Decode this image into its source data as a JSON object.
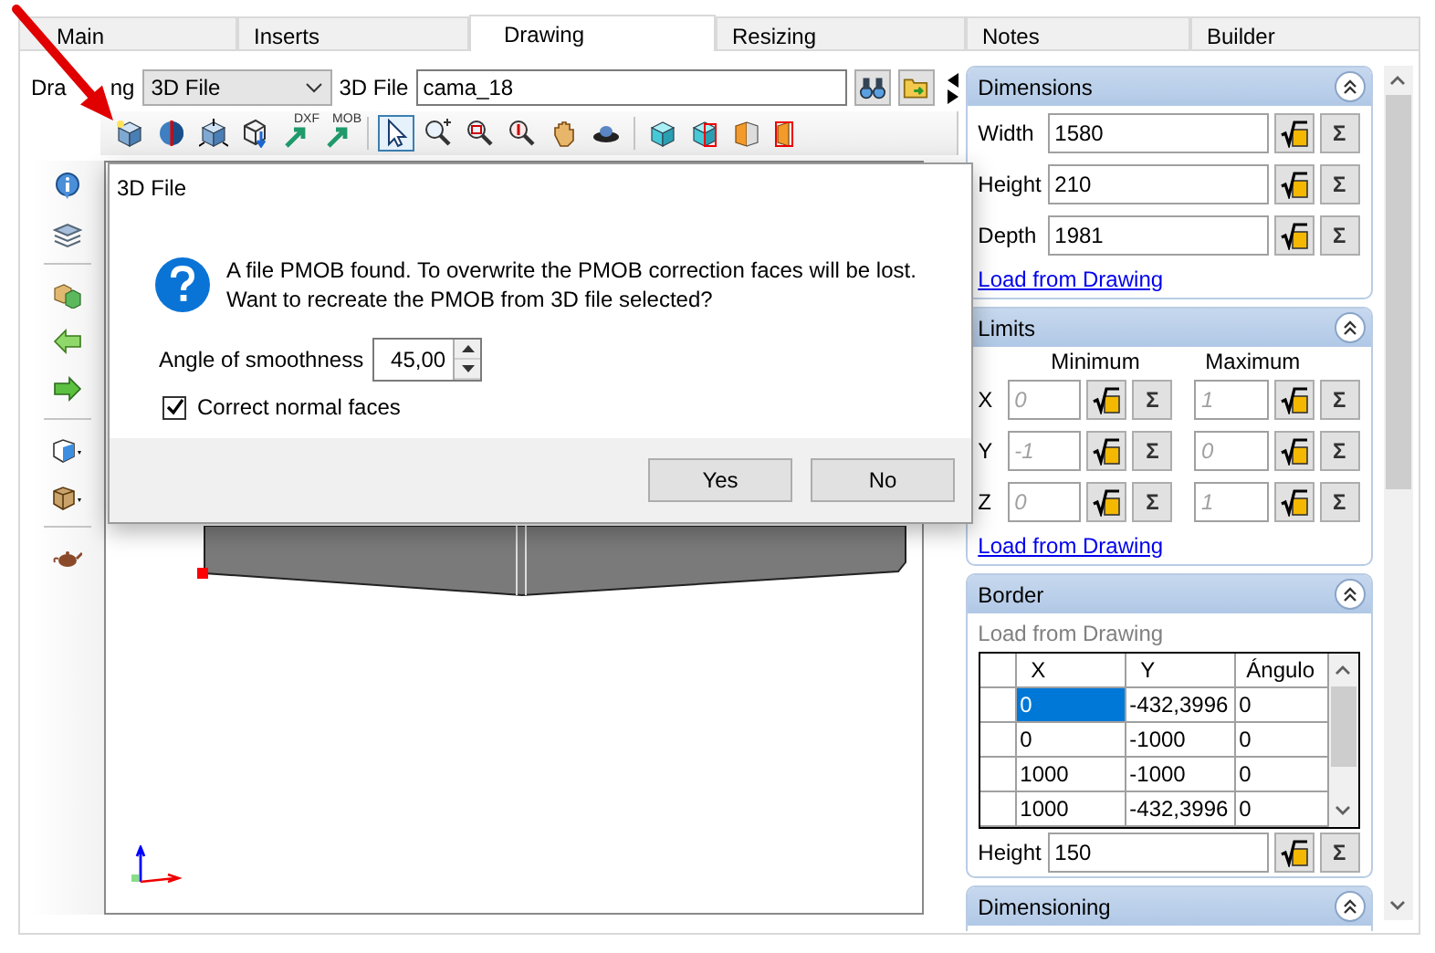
{
  "tabs": [
    {
      "label": "Main",
      "selected": false
    },
    {
      "label": "Inserts",
      "selected": false
    },
    {
      "label": "Drawing",
      "selected": true
    },
    {
      "label": "Resizing",
      "selected": false
    },
    {
      "label": "Notes",
      "selected": false
    },
    {
      "label": "Builder",
      "selected": false
    }
  ],
  "drawing": {
    "label_parts": [
      "Dra",
      "ng"
    ],
    "type_value": "3D File",
    "file_label": "3D File",
    "file_value": "cama_18"
  },
  "toolbar": {
    "badges": [
      "DXF",
      "MOB"
    ],
    "pointer_selected": true
  },
  "dialog": {
    "title": "3D File",
    "message": [
      "A file PMOB found. To overwrite the PMOB correction faces will be lost.",
      "Want to recreate the PMOB from 3D file selected?"
    ],
    "angle_label": "Angle of smoothness",
    "angle_value": "45,00",
    "checkbox": {
      "label": "Correct normal faces",
      "checked": true
    },
    "buttons": [
      "Yes",
      "No"
    ]
  },
  "dimensions": {
    "title": "Dimensions",
    "expanded": true,
    "fields": [
      {
        "label": "Width",
        "value": "1580",
        "sum": "Σ"
      },
      {
        "label": "Height",
        "value": "210",
        "sum": "Σ"
      },
      {
        "label": "Depth",
        "value": "1981",
        "sum": "Σ"
      }
    ],
    "link": "Load from Drawing"
  },
  "limits": {
    "title": "Limits",
    "expanded": true,
    "min_label": "Minimum",
    "max_label": "Maximum",
    "rows": [
      {
        "axis": "X",
        "min": "0",
        "max": "1",
        "min_sum": "Σ",
        "max_sum": "Σ",
        "disabled": true
      },
      {
        "axis": "Y",
        "min": "-1",
        "max": "0",
        "min_sum": "Σ",
        "max_sum": "Σ",
        "disabled": true
      },
      {
        "axis": "Z",
        "min": "0",
        "max": "1",
        "min_sum": "Σ",
        "max_sum": "Σ",
        "disabled": true
      }
    ],
    "link": "Load from Drawing"
  },
  "border": {
    "title": "Border",
    "expanded": true,
    "load_label": "Load from Drawing",
    "load_disabled": true,
    "columns": [
      "X",
      "Y",
      "Ángulo"
    ],
    "rows": [
      {
        "cells": [
          "0",
          "-432,3996",
          "0"
        ],
        "selected": true
      },
      {
        "cells": [
          "0",
          "-1000",
          "0"
        ],
        "selected": false
      },
      {
        "cells": [
          "1000",
          "-1000",
          "0"
        ],
        "selected": false
      },
      {
        "cells": [
          "1000",
          "-432,3996",
          "0"
        ],
        "selected": false
      }
    ],
    "height": {
      "label": "Height",
      "value": "150",
      "sum": "Σ"
    }
  },
  "dimensioning": {
    "title": "Dimensioning",
    "expanded": true
  }
}
